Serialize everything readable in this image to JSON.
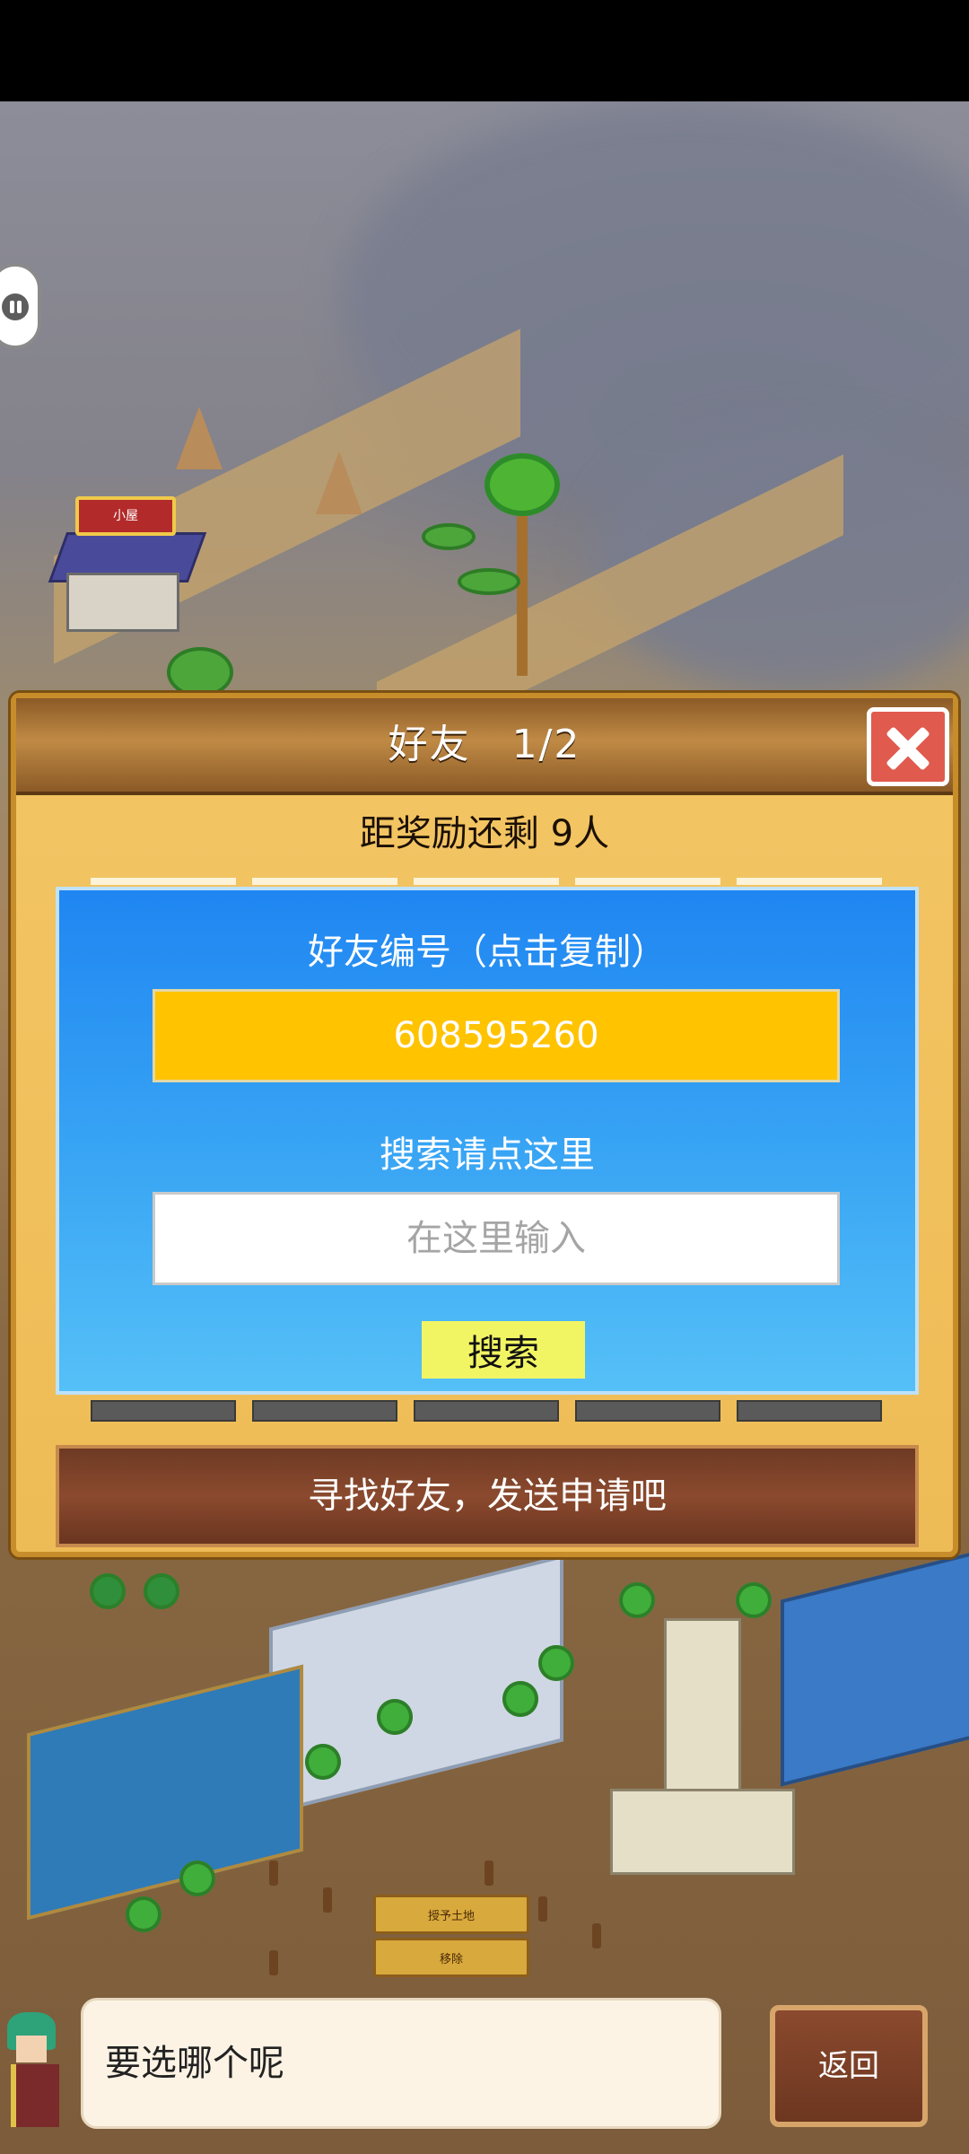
{
  "scene": {
    "house_sign": "小屋",
    "wood_sign_1": "授予土地",
    "wood_sign_2": "移除"
  },
  "dialog": {
    "title": "好友　1/2",
    "reward_text": "距奖励还剩 9人",
    "friend_id_label": "好友编号（点击复制）",
    "friend_id_value": "608595260",
    "search_label": "搜索请点这里",
    "search_placeholder": "在这里输入",
    "search_button": "搜索",
    "find_friend_banner": "寻找好友，发送申请吧"
  },
  "bottom": {
    "bubble_text": "要选哪个呢",
    "return_button": "返回"
  },
  "colors": {
    "dialog_bg": "#f3c564",
    "panel_blue": "#1f86f2",
    "friend_id_box": "#ffc300",
    "search_button": "#f2f563",
    "close_red": "#e05a4e"
  }
}
